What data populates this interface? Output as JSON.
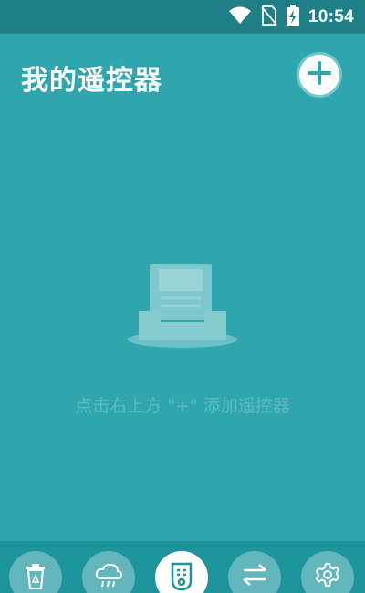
{
  "status_bar": {
    "time": "10:54",
    "icons": [
      "wifi-icon",
      "no-sim-icon",
      "battery-charging-icon"
    ]
  },
  "header": {
    "title": "我的遥控器",
    "add_icon": "plus-icon"
  },
  "empty_state": {
    "icon": "empty-tray-icon",
    "message": "点击右上方 \"+\" 添加遥控器"
  },
  "bottom_nav": {
    "items": [
      {
        "icon": "recycle-bin-icon",
        "active": false
      },
      {
        "icon": "cloud-rain-icon",
        "active": false
      },
      {
        "icon": "remote-face-icon",
        "active": true
      },
      {
        "icon": "swap-arrows-icon",
        "active": false
      },
      {
        "icon": "gear-icon",
        "active": false
      }
    ]
  },
  "colors": {
    "background": "#2fa6ae",
    "status_bar": "#1f7f87",
    "bottom_nav": "#1d949c",
    "nav_button": "#63b6bb",
    "active_nav_button": "#ffffff",
    "hint_text": "#5bbcc2"
  }
}
